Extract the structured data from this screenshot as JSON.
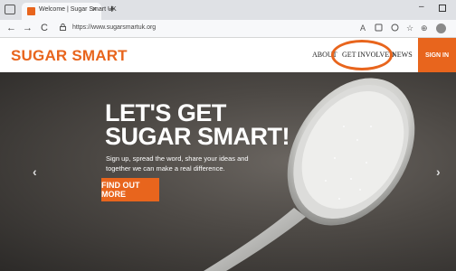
{
  "browser": {
    "tab_title": "Welcome | Sugar Smart UK",
    "tab_close": "×",
    "new_tab": "+",
    "window_minimize": "–",
    "url": "https://www.sugarsmartuk.org",
    "icons": {
      "back": "←",
      "forward": "→",
      "reload": "C",
      "lock": "🔒",
      "read_aloud": "A",
      "favorites_star": "☆",
      "collections": "⊕"
    }
  },
  "site": {
    "brand": "SUGAR SMART",
    "nav": {
      "about": "ABOUT",
      "get_involved": "GET INVOLVED",
      "news": "NEWS",
      "sign_in": "SIGN IN"
    },
    "accent_color": "#e8651d"
  },
  "hero": {
    "title": "LET'S GET SUGAR SMART!",
    "subtitle": "Sign up, spread the word, share your ideas and together we can make a real difference.",
    "cta_label": "FIND OUT MORE",
    "prev_arrow": "‹",
    "next_arrow": "›"
  }
}
